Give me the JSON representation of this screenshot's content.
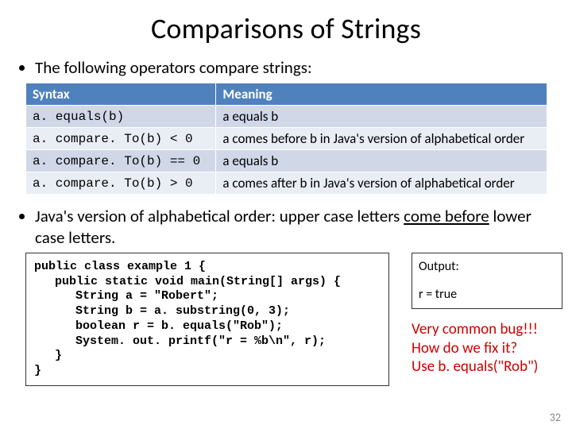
{
  "title": "Comparisons of Strings",
  "bullet1": "The following operators compare strings:",
  "table": {
    "head": {
      "c0": "Syntax",
      "c1": "Meaning"
    },
    "rows": {
      "r0": {
        "syntax": "a. equals(b)",
        "meaning": "a equals b"
      },
      "r1": {
        "syntax": "a. compare. To(b) <  0",
        "meaning": "a comes before b in Java's version of alphabetical order"
      },
      "r2": {
        "syntax": "a. compare. To(b) == 0",
        "meaning": "a equals b"
      },
      "r3": {
        "syntax": "a. compare. To(b) >  0",
        "meaning": "a comes after b in Java's version of alphabetical order"
      }
    }
  },
  "bullet2_pre": "Java's version of alphabetical order: upper case letters ",
  "bullet2_underline": "come before",
  "bullet2_post": " lower case letters.",
  "code": {
    "l0": "public class example 1 {",
    "l1": "public static void main(String[] args) {",
    "l2": "String a = \"Robert\";",
    "l3": "String b = a. substring(0, 3);",
    "l4": "boolean r = b. equals(\"Rob\");",
    "l5": "System. out. printf(\"r = %b\\n\", r);",
    "l6": "}",
    "l7": "}"
  },
  "output": {
    "label": "Output:",
    "line": "r = true"
  },
  "sidenote": {
    "l0": "Very common bug!!!",
    "l1": "How do we fix it?",
    "l2": "Use b. equals(\"Rob\")"
  },
  "pagenum": "32"
}
